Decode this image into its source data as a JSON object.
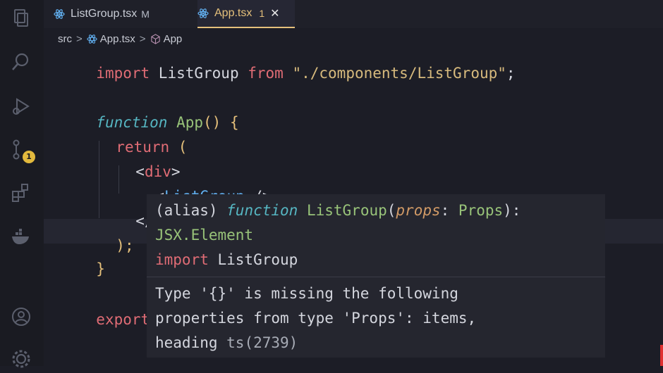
{
  "tabs": [
    {
      "name": "ListGroup.tsx",
      "status": "M"
    },
    {
      "name": "App.tsx",
      "problems": "1",
      "close": "✕"
    }
  ],
  "breadcrumb": [
    "src",
    ">",
    "App.tsx",
    ">",
    "App"
  ],
  "code": {
    "l1": {
      "kw": "import",
      "name": " ListGroup ",
      "from": "from",
      "str": " \"./components/ListGroup\"",
      "end": ";"
    },
    "l2": {
      "kw": "function",
      "name": " App",
      "paren": "() ",
      "brace": "{"
    },
    "l3": {
      "kw": "return",
      "paren": " ("
    },
    "l4": {
      "open": "<",
      "tag": "div",
      "close": ">"
    },
    "l5": {
      "open": "<",
      "tag": "ListGroup",
      "close": " />"
    },
    "l6": {
      "open": "</",
      "tag": "d"
    },
    "l7": {
      "text": ");"
    },
    "l8": {
      "brace": "}"
    },
    "l9": {
      "kw": "export"
    }
  },
  "hover": {
    "sig1": {
      "alias": "(alias) ",
      "fnkw": "function",
      "name": " ListGroup",
      "paren": "(",
      "param": "props",
      "colon": ": ",
      "type": "Props",
      "end": "):"
    },
    "sig2": "JSX.Element",
    "sig3": {
      "kw": "import",
      "name": " ListGroup"
    },
    "msg1": "Type '{}' is missing the following",
    "msg2": "properties from type 'Props': items,",
    "msg3": {
      "text": "heading",
      "code": " ts(2739)"
    }
  },
  "badge": "1",
  "colors": {
    "accent": "#e5c07b",
    "error": "#e06c75"
  }
}
